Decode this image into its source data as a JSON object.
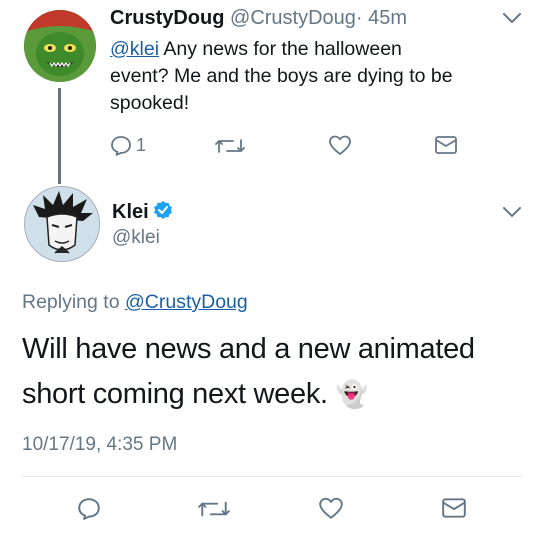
{
  "reply_tweet": {
    "display_name": "CrustyDoug",
    "handle": "@CrustyDoug",
    "separator": "·",
    "time": "45m",
    "mention": "@klei",
    "text_after_mention": " Any news for the halloween",
    "text_line2": "event? Me and the boys are dying to be",
    "text_line3": "spooked!",
    "reply_count": "1",
    "icons": [
      "reply-icon",
      "retweet-icon",
      "like-icon",
      "dm-icon"
    ]
  },
  "main_tweet": {
    "display_name": "Klei",
    "verified_icon": "verified-badge-icon",
    "handle": "@klei",
    "replying_prefix": "Replying to ",
    "replying_to": "@CrustyDoug",
    "text_line1": "Will have news and a new animated",
    "text_line2": "short coming next week.",
    "emoji": "👻",
    "timestamp": "10/17/19, 4:35 PM",
    "icons": [
      "reply-icon",
      "retweet-icon",
      "like-icon",
      "dm-icon"
    ]
  },
  "colors": {
    "link": "#1b5fa8",
    "verified": "#1da1f2",
    "muted": "#657786",
    "thread_line": "#6f7378"
  }
}
